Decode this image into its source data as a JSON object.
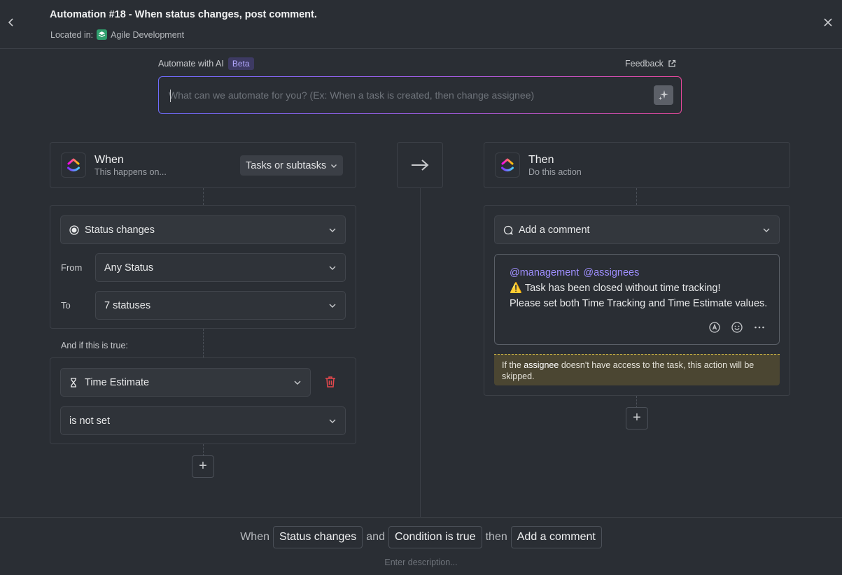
{
  "header": {
    "title": "Automation #18 - When status changes, post comment.",
    "located_label": "Located in:",
    "location": "Agile Development"
  },
  "ai": {
    "label": "Automate with AI",
    "badge": "Beta",
    "feedback": "Feedback",
    "placeholder": "What can we automate for you? (Ex: When a task is created, then change assignee)"
  },
  "when": {
    "title": "When",
    "subtitle": "This happens on...",
    "scope": "Tasks or subtasks",
    "trigger": "Status changes",
    "from_label": "From",
    "from_value": "Any Status",
    "to_label": "To",
    "to_value": "7 statuses"
  },
  "condition": {
    "label": "And if this is true:",
    "field": "Time Estimate",
    "operator": "is not set"
  },
  "then": {
    "title": "Then",
    "subtitle": "Do this action",
    "action": "Add a comment",
    "mentions": [
      "@management",
      "@assignees"
    ],
    "line1": "Task has been closed without time tracking!",
    "line2": "Please set both Time Tracking and Time Estimate values.",
    "warning_emoji": "⚠️",
    "note_prefix": "If the",
    "note_bold": "assignee",
    "note_suffix": "doesn't have access to the task, this action will be skipped."
  },
  "summary": {
    "when": "When",
    "trigger": "Status changes",
    "and": "and",
    "condition": "Condition is true",
    "then": "then",
    "action": "Add a comment",
    "description_placeholder": "Enter description..."
  },
  "colors": {
    "background": "#2a2e34",
    "accent_purple": "#9f8fff",
    "delete_red": "#e5484d",
    "note_bg": "#4b4632"
  }
}
